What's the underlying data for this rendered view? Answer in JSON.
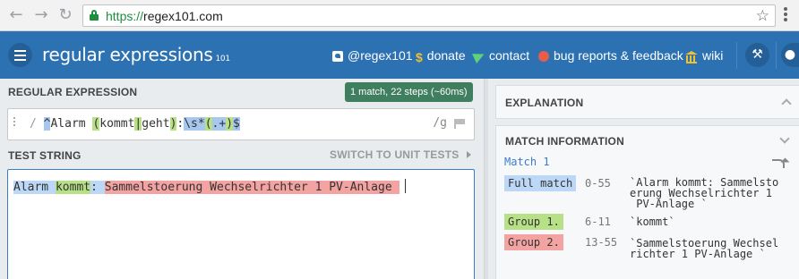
{
  "browser": {
    "back": "←",
    "forward": "→",
    "reload": "↻",
    "url_scheme": "https://",
    "url_host": "regex101.com",
    "star": "☆"
  },
  "header": {
    "brand_a": "regular",
    "brand_b": "expressions",
    "brand_sup": "101",
    "nav": {
      "twitter": "@regex101",
      "donate": "donate",
      "contact": "contact",
      "bugs": "bug reports & feedback",
      "wiki": "wiki"
    },
    "wrench_icon": "wrench-icon",
    "user_icon": "user-icon"
  },
  "editor": {
    "regex_title": "REGULAR EXPRESSION",
    "badge": "1 match, 22 steps (~60ms)",
    "delim_open": "/",
    "delim_close": "/",
    "flags": "g",
    "regex": {
      "anchor": "^",
      "lit": "Alarm ",
      "paren_open": "(",
      "alt1": "kommt",
      "pipe": "|",
      "alt2": "geht",
      "paren_close": ")",
      "colon": ":",
      "ws": "\\s*",
      "g2_open": "(",
      "g2_body": ".+",
      "g2_close": ")",
      "end": "$"
    },
    "test_title": "TEST STRING",
    "switch_label": "SWITCH TO UNIT TESTS",
    "test": {
      "pre": "Alarm ",
      "g1": "kommt",
      "mid": ": ",
      "g2": "Sammelstoerung Wechselrichter 1 PV-Anlage "
    }
  },
  "explanation": {
    "title": "EXPLANATION"
  },
  "match_info": {
    "title": "MATCH INFORMATION",
    "match_label": "Match 1",
    "rows": [
      {
        "tag": "Full match",
        "range": "0-55",
        "value": "`Alarm kommt: Sammelsto\nerung Wechselrichter 1\n PV-Anlage `",
        "color": "#bcd8f6"
      },
      {
        "tag": "Group 1.",
        "range": "6-11",
        "value": "`kommt`",
        "color": "#b7e087"
      },
      {
        "tag": "Group 2.",
        "range": "13-55",
        "value": "`Sammelstoerung Wechsel\nrichter 1 PV-Anlage `",
        "color": "#f4a3a3"
      }
    ]
  },
  "colors": {
    "header_blue": "#2c71b2",
    "badge_green": "#3f7f5f",
    "match_blue": "#bcd8f6",
    "group1_green": "#b7e087",
    "group2_red": "#f4a3a3"
  }
}
